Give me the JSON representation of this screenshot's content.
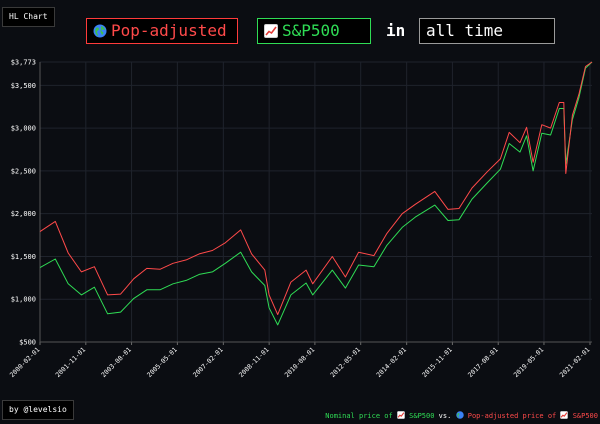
{
  "controls": {
    "hl_chart_label": "HL Chart",
    "metric_label": "Pop-adjusted",
    "asset_label": "S&P500",
    "in_word": "in",
    "range_label": "all time"
  },
  "icons": {
    "metric": "globe-icon",
    "asset": "chart-increasing-icon"
  },
  "credit": "by @levelsio",
  "legend": {
    "nominal_prefix": "Nominal price of",
    "asset": "S&P500",
    "vs": "vs.",
    "adjusted_prefix": "Pop-adjusted price of",
    "asset_2": "S&P500"
  },
  "colors": {
    "background": "#0b0d12",
    "nominal": "#2fdc55",
    "adjusted": "#ff4a4a",
    "grid": "#1f232c",
    "axis_text": "#ffffff"
  },
  "chart_data": {
    "type": "line",
    "ylim": [
      500,
      3773
    ],
    "y_ticks": [
      500,
      1000,
      1500,
      2000,
      2500,
      3000,
      3500,
      3773
    ],
    "y_tick_labels": [
      "$500",
      "$1,000",
      "$1,500",
      "$2,000",
      "$2,500",
      "$3,000",
      "$3,500",
      "$3,773"
    ],
    "xlim": [
      "2000-02-01",
      "2021-03-01"
    ],
    "x_tick_labels": [
      "2000-02-01",
      "2001-11-01",
      "2003-08-01",
      "2005-05-01",
      "2007-02-01",
      "2008-11-01",
      "2010-08-01",
      "2012-05-01",
      "2014-02-01",
      "2015-11-01",
      "2017-08-01",
      "2019-05-01",
      "2021-02-01"
    ],
    "grid": true,
    "series": [
      {
        "color": "#2fdc55",
        "points": [
          [
            "2000-02-01",
            1370
          ],
          [
            "2000-09-01",
            1470
          ],
          [
            "2001-03-01",
            1180
          ],
          [
            "2001-09-01",
            1050
          ],
          [
            "2002-03-01",
            1140
          ],
          [
            "2002-09-01",
            830
          ],
          [
            "2003-03-01",
            850
          ],
          [
            "2003-09-01",
            1010
          ],
          [
            "2004-03-01",
            1110
          ],
          [
            "2004-09-01",
            1110
          ],
          [
            "2005-03-01",
            1180
          ],
          [
            "2005-09-01",
            1220
          ],
          [
            "2006-03-01",
            1290
          ],
          [
            "2006-09-01",
            1320
          ],
          [
            "2007-03-01",
            1420
          ],
          [
            "2007-10-01",
            1550
          ],
          [
            "2008-03-01",
            1320
          ],
          [
            "2008-09-01",
            1160
          ],
          [
            "2008-11-01",
            900
          ],
          [
            "2009-03-01",
            700
          ],
          [
            "2009-09-01",
            1050
          ],
          [
            "2010-04-01",
            1190
          ],
          [
            "2010-07-01",
            1050
          ],
          [
            "2011-04-01",
            1340
          ],
          [
            "2011-10-01",
            1130
          ],
          [
            "2012-04-01",
            1400
          ],
          [
            "2012-11-01",
            1380
          ],
          [
            "2013-05-01",
            1630
          ],
          [
            "2013-12-01",
            1840
          ],
          [
            "2014-06-01",
            1960
          ],
          [
            "2015-03-01",
            2100
          ],
          [
            "2015-09-01",
            1920
          ],
          [
            "2016-02-01",
            1930
          ],
          [
            "2016-08-01",
            2170
          ],
          [
            "2017-03-01",
            2360
          ],
          [
            "2017-09-01",
            2520
          ],
          [
            "2018-01-01",
            2820
          ],
          [
            "2018-06-01",
            2720
          ],
          [
            "2018-09-01",
            2910
          ],
          [
            "2018-12-01",
            2500
          ],
          [
            "2019-04-01",
            2940
          ],
          [
            "2019-08-01",
            2920
          ],
          [
            "2019-12-01",
            3230
          ],
          [
            "2020-02-01",
            3230
          ],
          [
            "2020-03-01",
            2580
          ],
          [
            "2020-06-01",
            3100
          ],
          [
            "2020-09-01",
            3360
          ],
          [
            "2020-12-01",
            3700
          ],
          [
            "2021-03-01",
            3773
          ]
        ]
      },
      {
        "color": "#ff4a4a",
        "points": [
          [
            "2000-02-01",
            1790
          ],
          [
            "2000-09-01",
            1910
          ],
          [
            "2001-03-01",
            1540
          ],
          [
            "2001-09-01",
            1320
          ],
          [
            "2002-03-01",
            1380
          ],
          [
            "2002-09-01",
            1050
          ],
          [
            "2003-03-01",
            1060
          ],
          [
            "2003-09-01",
            1240
          ],
          [
            "2004-03-01",
            1360
          ],
          [
            "2004-09-01",
            1350
          ],
          [
            "2005-03-01",
            1420
          ],
          [
            "2005-09-01",
            1460
          ],
          [
            "2006-03-01",
            1530
          ],
          [
            "2006-09-01",
            1570
          ],
          [
            "2007-03-01",
            1660
          ],
          [
            "2007-10-01",
            1810
          ],
          [
            "2008-03-01",
            1530
          ],
          [
            "2008-09-01",
            1340
          ],
          [
            "2008-11-01",
            1050
          ],
          [
            "2009-03-01",
            820
          ],
          [
            "2009-09-01",
            1200
          ],
          [
            "2010-04-01",
            1340
          ],
          [
            "2010-07-01",
            1180
          ],
          [
            "2011-04-01",
            1500
          ],
          [
            "2011-10-01",
            1260
          ],
          [
            "2012-04-01",
            1550
          ],
          [
            "2012-11-01",
            1510
          ],
          [
            "2013-05-01",
            1770
          ],
          [
            "2013-12-01",
            2000
          ],
          [
            "2014-06-01",
            2110
          ],
          [
            "2015-03-01",
            2260
          ],
          [
            "2015-09-01",
            2050
          ],
          [
            "2016-02-01",
            2060
          ],
          [
            "2016-08-01",
            2300
          ],
          [
            "2017-03-01",
            2490
          ],
          [
            "2017-09-01",
            2640
          ],
          [
            "2018-01-01",
            2950
          ],
          [
            "2018-06-01",
            2830
          ],
          [
            "2018-09-01",
            3010
          ],
          [
            "2018-12-01",
            2600
          ],
          [
            "2019-04-01",
            3040
          ],
          [
            "2019-08-01",
            3000
          ],
          [
            "2019-12-01",
            3300
          ],
          [
            "2020-02-01",
            3300
          ],
          [
            "2020-03-01",
            2470
          ],
          [
            "2020-06-01",
            3150
          ],
          [
            "2020-09-01",
            3400
          ],
          [
            "2020-12-01",
            3720
          ],
          [
            "2021-03-01",
            3773
          ]
        ]
      }
    ]
  }
}
